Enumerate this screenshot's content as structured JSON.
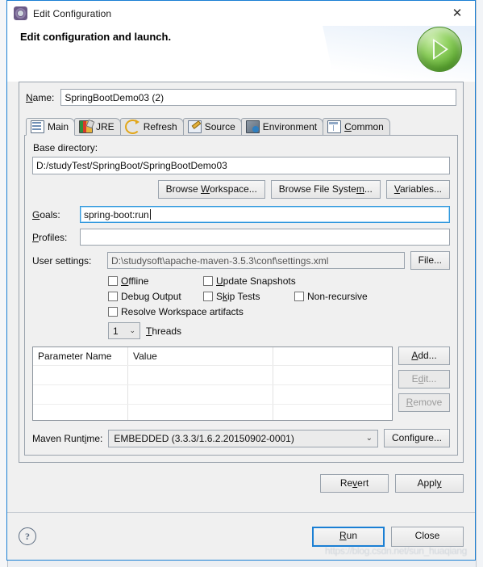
{
  "window": {
    "title": "Edit Configuration",
    "title_icon": "gear-icon",
    "close_label": "✕",
    "header_title": "Edit configuration and launch.",
    "header_icon": "green-run-play-icon"
  },
  "name_field": {
    "label": "Name:",
    "value": "SpringBootDemo03 (2)"
  },
  "tabs": [
    {
      "label": "Main",
      "icon": "main-document-icon",
      "active": true
    },
    {
      "label": "JRE",
      "icon": "jre-books-icon",
      "active": false
    },
    {
      "label": "Refresh",
      "icon": "refresh-arrows-icon",
      "active": false
    },
    {
      "label": "Source",
      "icon": "source-pencil-icon",
      "active": false
    },
    {
      "label": "Environment",
      "icon": "environment-monitor-icon",
      "active": false
    },
    {
      "label": "Common",
      "icon": "common-window-icon",
      "active": false
    }
  ],
  "main_tab": {
    "base_directory": {
      "label": "Base directory:",
      "value": "D:/studyTest/SpringBoot/SpringBootDemo03"
    },
    "browse_buttons": [
      {
        "label": "Browse Workspace...",
        "enabled": true
      },
      {
        "label": "Browse File System...",
        "enabled": true
      },
      {
        "label": "Variables...",
        "enabled": true
      }
    ],
    "goals": {
      "label": "Goals:",
      "value": "spring-boot:run",
      "focused": true
    },
    "profiles": {
      "label": "Profiles:",
      "value": ""
    },
    "user_settings": {
      "label": "User settings:",
      "value": "D:\\studysoft\\apache-maven-3.5.3\\conf\\settings.xml",
      "button_label": "File..."
    },
    "checkboxes": [
      {
        "label": "Offline",
        "checked": false
      },
      {
        "label": "Update Snapshots",
        "checked": false
      },
      {
        "label": "Debug Output",
        "checked": false
      },
      {
        "label": "Skip Tests",
        "checked": false
      },
      {
        "label": "Non-recursive",
        "checked": false
      },
      {
        "label": "Resolve Workspace artifacts",
        "checked": false
      }
    ],
    "threads": {
      "value": "1",
      "label": "Threads",
      "arrow": "⌄"
    },
    "parameter_table": {
      "columns": [
        "Parameter Name",
        "Value",
        ""
      ],
      "rows": [],
      "empty_row_count": 3,
      "buttons": [
        {
          "label": "Add...",
          "enabled": true
        },
        {
          "label": "Edit...",
          "enabled": false
        },
        {
          "label": "Remove",
          "enabled": false
        }
      ]
    },
    "maven_runtime": {
      "label": "Maven Runtime:",
      "value": "EMBEDDED (3.3.3/1.6.2.20150902-0001)",
      "arrow": "⌄",
      "button_label": "Configure..."
    },
    "revert_label": "Revert",
    "apply_label": "Apply"
  },
  "footer": {
    "help_label": "?",
    "run_label": "Run",
    "close_label": "Close",
    "watermark": "https://blog.csdn.net/sun_huaqiang"
  },
  "colors": {
    "window_border": "#1a7fd4",
    "default_button_border": "#1a7fd4",
    "focus_border": "#3399dd",
    "dialog_bg": "#f0f0f0",
    "run_icon_green": "#5faa33"
  }
}
